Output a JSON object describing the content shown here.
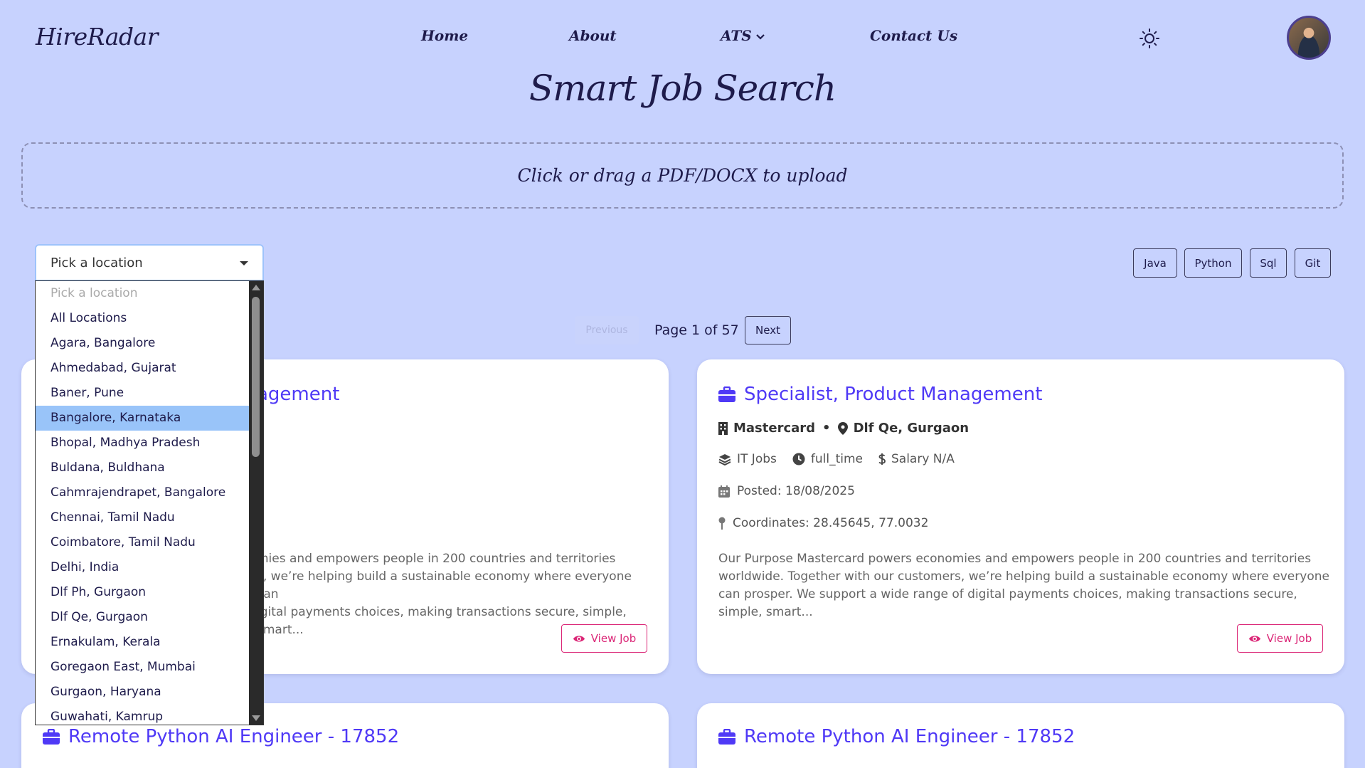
{
  "header": {
    "logo": "HireRadar",
    "nav": {
      "home": "Home",
      "about": "About",
      "ats": "ATS",
      "contact": "Contact Us"
    }
  },
  "page_title": "Smart Job Search",
  "upload": {
    "label": "Click or drag a PDF/DOCX to upload"
  },
  "location": {
    "selected_label": "Pick a location",
    "options": [
      "Pick a location",
      "All Locations",
      "Agara, Bangalore",
      "Ahmedabad, Gujarat",
      "Baner, Pune",
      "Bangalore, Karnataka",
      "Bhopal, Madhya Pradesh",
      "Buldana, Buldhana",
      "Cahmrajendrapet, Bangalore",
      "Chennai, Tamil Nadu",
      "Coimbatore, Tamil Nadu",
      "Delhi, India",
      "Dlf Ph, Gurgaon",
      "Dlf Qe, Gurgaon",
      "Ernakulam, Kerala",
      "Goregaon East, Mumbai",
      "Gurgaon, Haryana",
      "Guwahati, Kamrup"
    ]
  },
  "skills": [
    "Java",
    "Python",
    "Sql",
    "Git"
  ],
  "pagination": {
    "previous": "Previous",
    "info": "Page 1 of 57",
    "next": "Next"
  },
  "cards": [
    {
      "title": "agement",
      "desc": "mies and empowers people in 200 countries and territories\ns, we’re helping build a sustainable economy where everyone can\nigital payments choices, making transactions secure, simple, smart...",
      "view": "View Job"
    },
    {
      "title": "Specialist, Product Management",
      "company": "Mastercard",
      "location": "Dlf Qe, Gurgaon",
      "category": "IT Jobs",
      "type": "full_time",
      "salary": "Salary N/A",
      "posted": "Posted: 18/08/2025",
      "coords": "Coordinates: 28.45645, 77.0032",
      "desc": "Our Purpose Mastercard powers economies and empowers people in 200 countries and territories worldwide. Together with our customers, we’re helping build a sustainable economy where everyone can prosper. We support a wide range of digital payments choices, making transactions secure, simple, smart...",
      "view": "View Job"
    },
    {
      "title": "Remote Python AI Engineer - 17852"
    },
    {
      "title": "Remote Python AI Engineer - 17852"
    }
  ],
  "colors": {
    "background": "#c7d2fe",
    "accent": "#4f39f6",
    "view_button": "#db2777",
    "selected_option": "#99c4f9"
  }
}
